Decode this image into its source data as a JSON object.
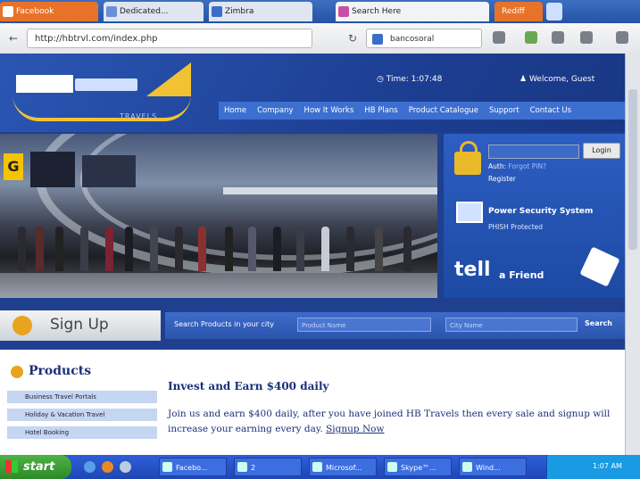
{
  "browser": {
    "tabs": [
      {
        "label": "Facebook",
        "color": "#e8722a"
      },
      {
        "label": "Dedicated...",
        "color": "#dfe6f2"
      },
      {
        "label": "Zimbra",
        "color": "#dfe6f2"
      },
      {
        "label": "Search Here",
        "color": "#f1f3f7"
      },
      {
        "label": "Rediff",
        "color": "#e8722a"
      }
    ],
    "url": "http://hbtrvl.com/index.php",
    "search_value": "bancosoral",
    "back_icon": "back-arrow-icon",
    "reload_icon": "reload-icon"
  },
  "header": {
    "logo_tagline": "TRAVELS",
    "clock": "Time: 1:07:48",
    "welcome": "Welcome, Guest",
    "nav": [
      "Home",
      "Company",
      "How It Works",
      "HB Plans",
      "Product Catalogue",
      "Support",
      "Contact Us"
    ]
  },
  "hero": {
    "sign_letter": "G"
  },
  "sidebar": {
    "login_button": "Login",
    "auth_label": "Auth:",
    "forgot_label": "Forgot PIN?",
    "register_label": "Register",
    "security_title": "Power Security System",
    "security_sub": "PHISH Protected",
    "tell_big": "tell",
    "tell_small": "a Friend"
  },
  "signup": {
    "label": "Sign Up"
  },
  "search": {
    "label": "Search Products in your city",
    "keyword_placeholder": "Product Name",
    "city_placeholder": "City Name",
    "button": "Search"
  },
  "products": {
    "title": "Products",
    "items": [
      "Business Travel Portals",
      "Holiday & Vacation Travel",
      "Hotel Booking"
    ]
  },
  "content": {
    "title": "Invest and Earn $400 daily",
    "body": "Join us and earn $400 daily, after you have joined HB Travels then every sale and signup will increase your earning every day.",
    "link": "Signup Now"
  },
  "taskbar": {
    "start": "start",
    "tasks": [
      "Facebo...",
      "2",
      "Microsof...",
      "Skype™...",
      "Wind..."
    ],
    "clock": "1:07 AM"
  }
}
